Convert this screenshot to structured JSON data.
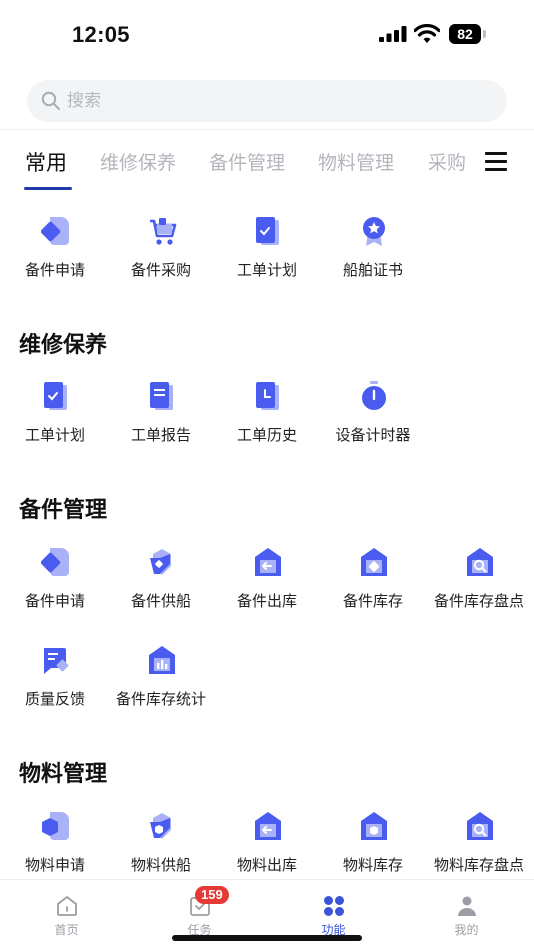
{
  "status_bar": {
    "time": "12:05",
    "battery": "82"
  },
  "search": {
    "placeholder": "搜索"
  },
  "tabs": [
    {
      "label": "常用",
      "active": true
    },
    {
      "label": "维修保养",
      "active": false
    },
    {
      "label": "备件管理",
      "active": false
    },
    {
      "label": "物料管理",
      "active": false
    },
    {
      "label": "采购",
      "active": false
    }
  ],
  "sections": {
    "common": {
      "items": [
        {
          "label": "备件申请",
          "icon": "spare-part-request-icon"
        },
        {
          "label": "备件采购",
          "icon": "shopping-cart-icon"
        },
        {
          "label": "工单计划",
          "icon": "work-order-plan-icon"
        },
        {
          "label": "船舶证书",
          "icon": "certificate-badge-icon"
        }
      ]
    },
    "maintenance": {
      "title": "维修保养",
      "items": [
        {
          "label": "工单计划",
          "icon": "work-order-plan-icon"
        },
        {
          "label": "工单报告",
          "icon": "work-order-report-icon"
        },
        {
          "label": "工单历史",
          "icon": "work-order-history-icon"
        },
        {
          "label": "设备计时器",
          "icon": "timer-icon"
        }
      ]
    },
    "spare_parts": {
      "title": "备件管理",
      "items": [
        {
          "label": "备件申请",
          "icon": "spare-part-request-icon"
        },
        {
          "label": "备件供船",
          "icon": "spare-part-supply-icon"
        },
        {
          "label": "备件出库",
          "icon": "warehouse-out-icon"
        },
        {
          "label": "备件库存",
          "icon": "warehouse-stock-icon"
        },
        {
          "label": "备件库存盘点",
          "icon": "warehouse-inventory-check-icon"
        },
        {
          "label": "质量反馈",
          "icon": "quality-feedback-icon"
        },
        {
          "label": "备件库存统计",
          "icon": "warehouse-statistics-icon"
        }
      ]
    },
    "materials": {
      "title": "物料管理",
      "items": [
        {
          "label": "物料申请",
          "icon": "material-request-icon"
        },
        {
          "label": "物料供船",
          "icon": "material-supply-icon"
        },
        {
          "label": "物料出库",
          "icon": "warehouse-out-icon"
        },
        {
          "label": "物料库存",
          "icon": "material-stock-icon"
        },
        {
          "label": "物料库存盘点",
          "icon": "warehouse-inventory-check-icon"
        }
      ]
    }
  },
  "tabbar": {
    "items": [
      {
        "label": "首页",
        "icon": "home-icon",
        "active": false
      },
      {
        "label": "任务",
        "icon": "task-icon",
        "active": false,
        "badge": "159"
      },
      {
        "label": "功能",
        "icon": "apps-icon",
        "active": true
      },
      {
        "label": "我的",
        "icon": "profile-icon",
        "active": false
      }
    ]
  },
  "colors": {
    "accent": "#4a5cf0",
    "accent_dark": "#1f3aa8",
    "tab_active_text": "#3a55d8",
    "badge": "#e53935"
  }
}
